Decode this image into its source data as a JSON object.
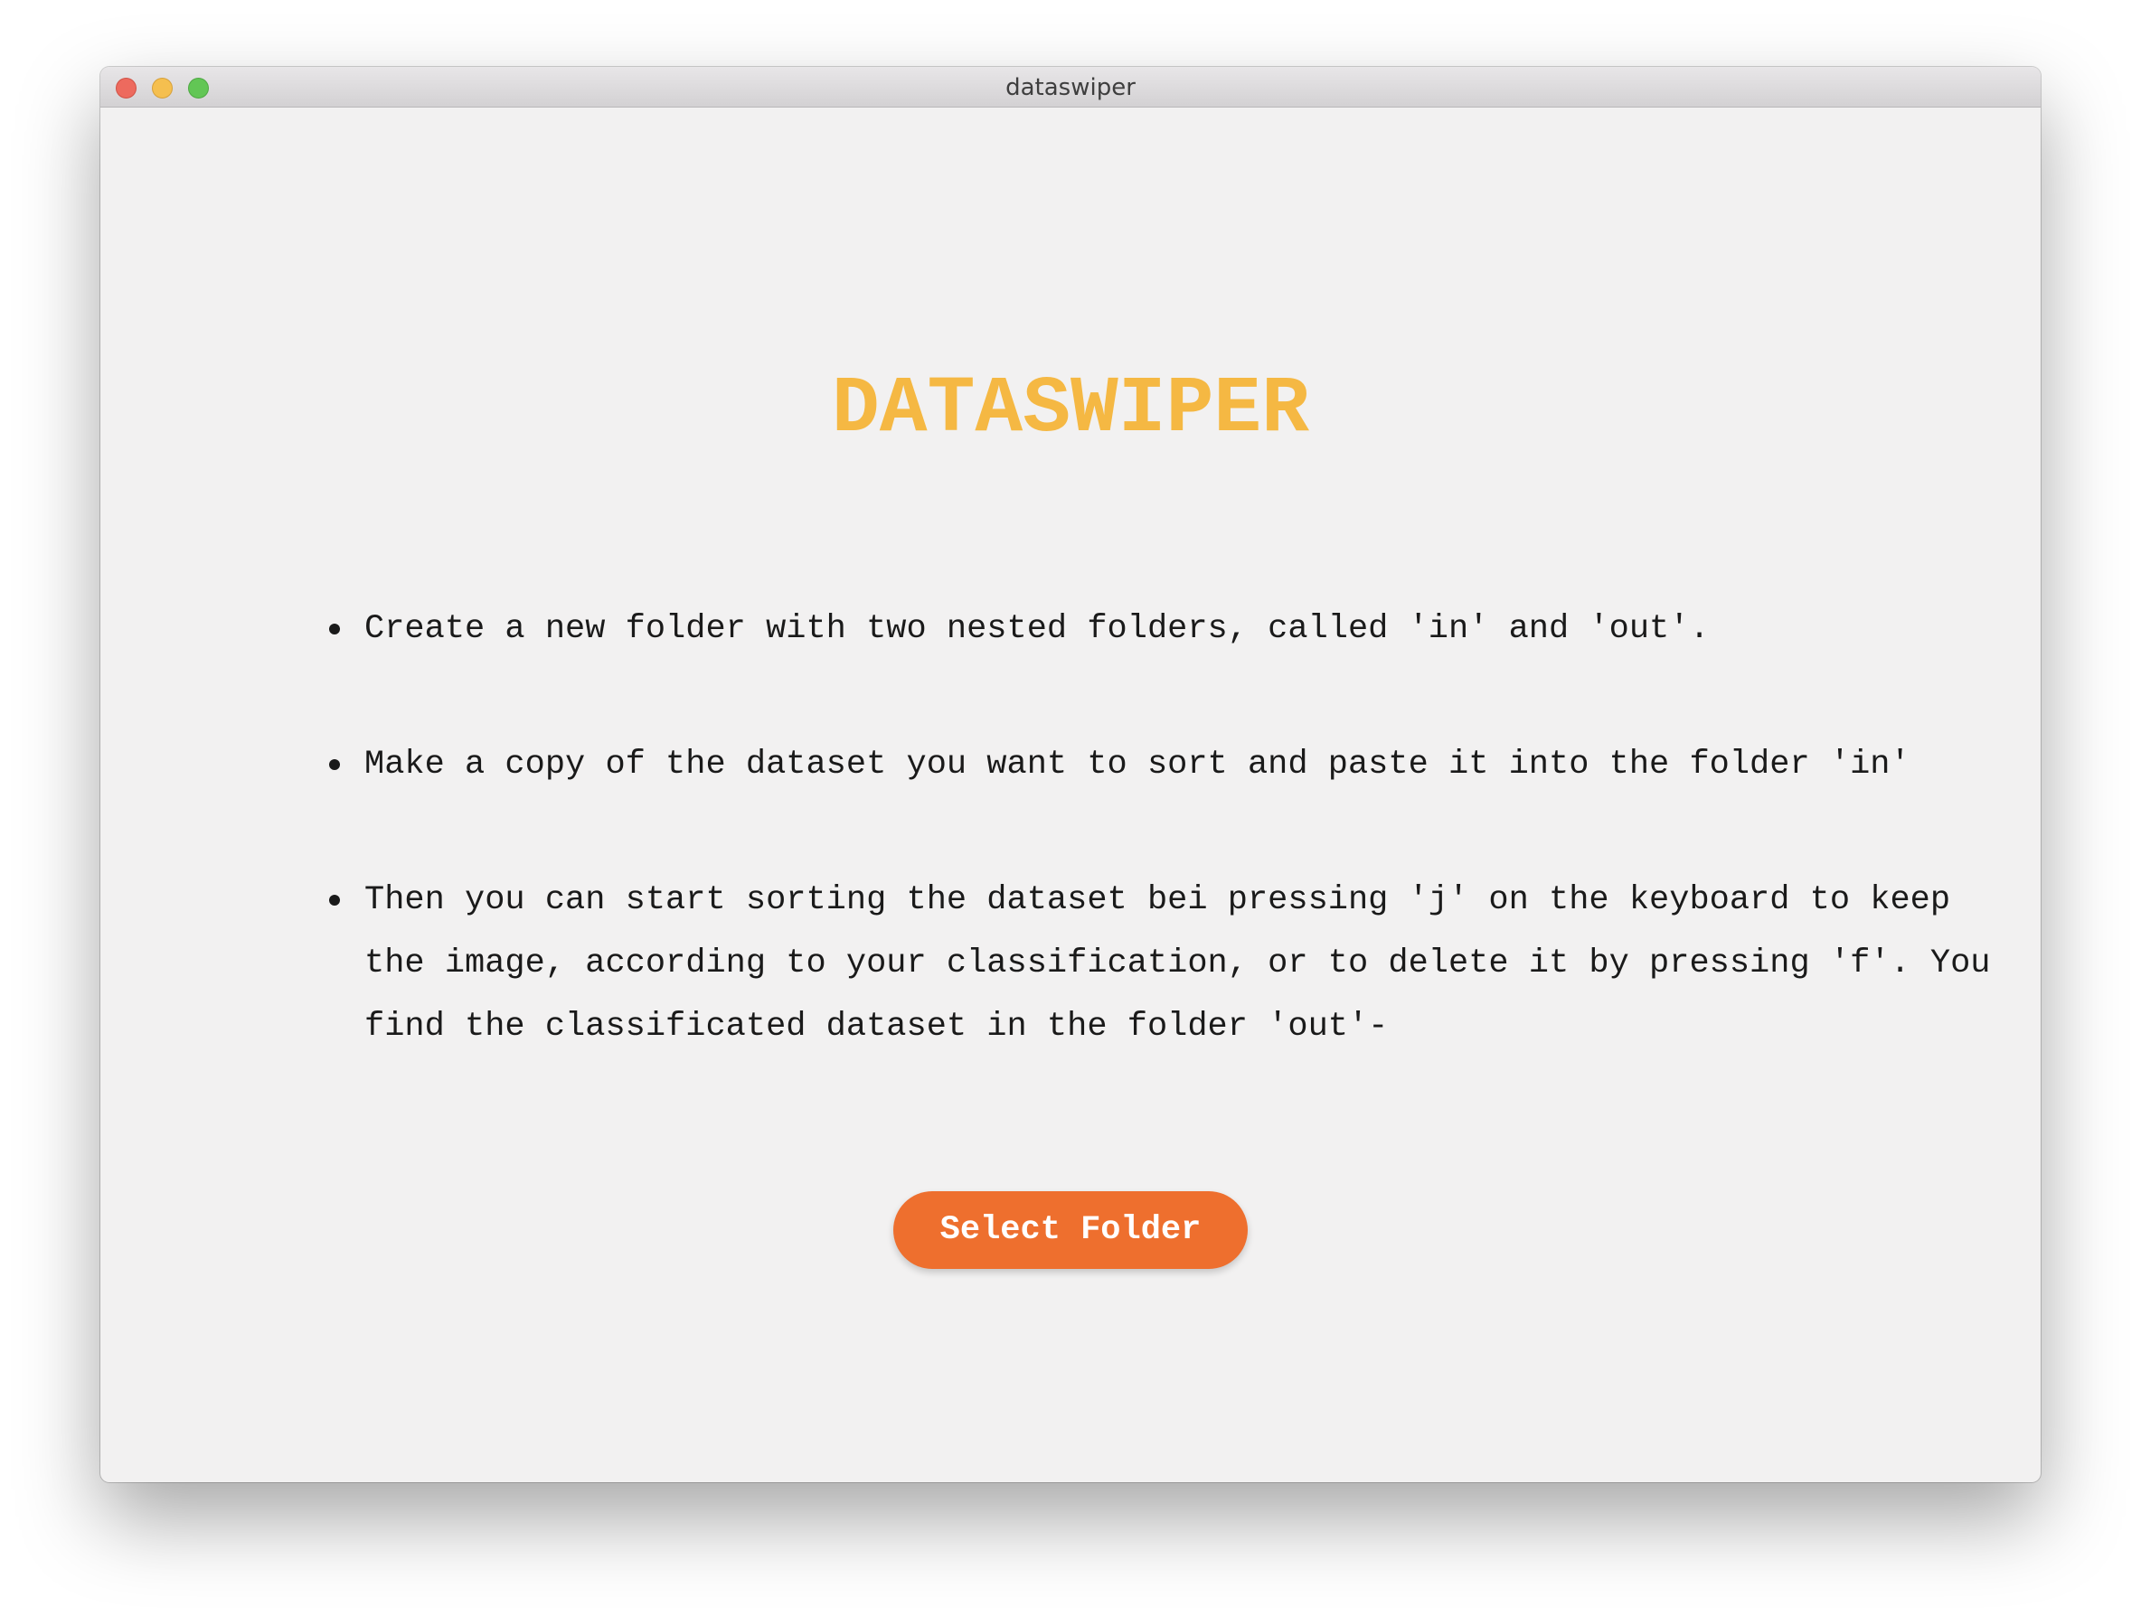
{
  "window": {
    "title": "dataswiper"
  },
  "main": {
    "heading": "DATASWIPER",
    "instructions": [
      "Create a new folder with two nested folders, called 'in' and 'out'.",
      "Make a copy of the dataset you want to sort and paste it into the folder 'in'",
      "Then you can start sorting the dataset bei pressing 'j' on the keyboard to keep the image, according to your classification, or to delete it by pressing 'f'. You find the classificated dataset in the folder 'out'-"
    ],
    "select_button_label": "Select Folder"
  },
  "colors": {
    "heading": "#f5b843",
    "button_background": "#ee6f2e",
    "button_text": "#ffffff",
    "window_background": "#f2f1f1"
  }
}
